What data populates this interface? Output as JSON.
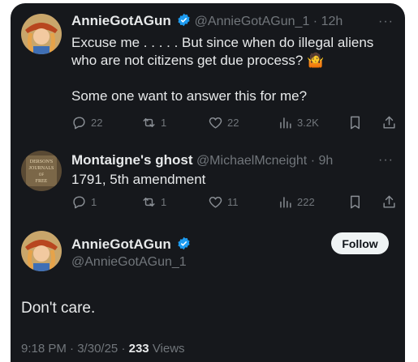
{
  "tweet1": {
    "name": "AnnieGotAGun",
    "handle": "@AnnieGotAGun_1",
    "time": "12h",
    "line1": "Excuse me . . . . . But since when do illegal aliens",
    "line2": "who are not citizens get due process?",
    "emoji": "🤷",
    "line3": "Some one want to answer this for me?",
    "stats": {
      "replies": "22",
      "reposts": "1",
      "likes": "22",
      "views": "3.2K"
    }
  },
  "tweet2": {
    "name": "Montaigne's ghost",
    "handle": "@MichaelMcneight",
    "time": "9h",
    "avatar_text": [
      "DERSON'S",
      "JOURNALS",
      "OF",
      "FREE"
    ],
    "text": "1791, 5th amendment",
    "stats": {
      "replies": "1",
      "reposts": "1",
      "likes": "11",
      "views": "222"
    }
  },
  "main": {
    "name": "AnnieGotAGun",
    "handle": "@AnnieGotAGun_1",
    "follow_label": "Follow",
    "text": "Don't care.",
    "time": "9:18 PM",
    "date": "3/30/25",
    "views_count": "233",
    "views_label": "Views"
  },
  "separator": "·",
  "colors": {
    "card_bg": "#16181c",
    "text": "#e7e9ea",
    "muted": "#71767b",
    "verified": "#1d9bf0"
  }
}
